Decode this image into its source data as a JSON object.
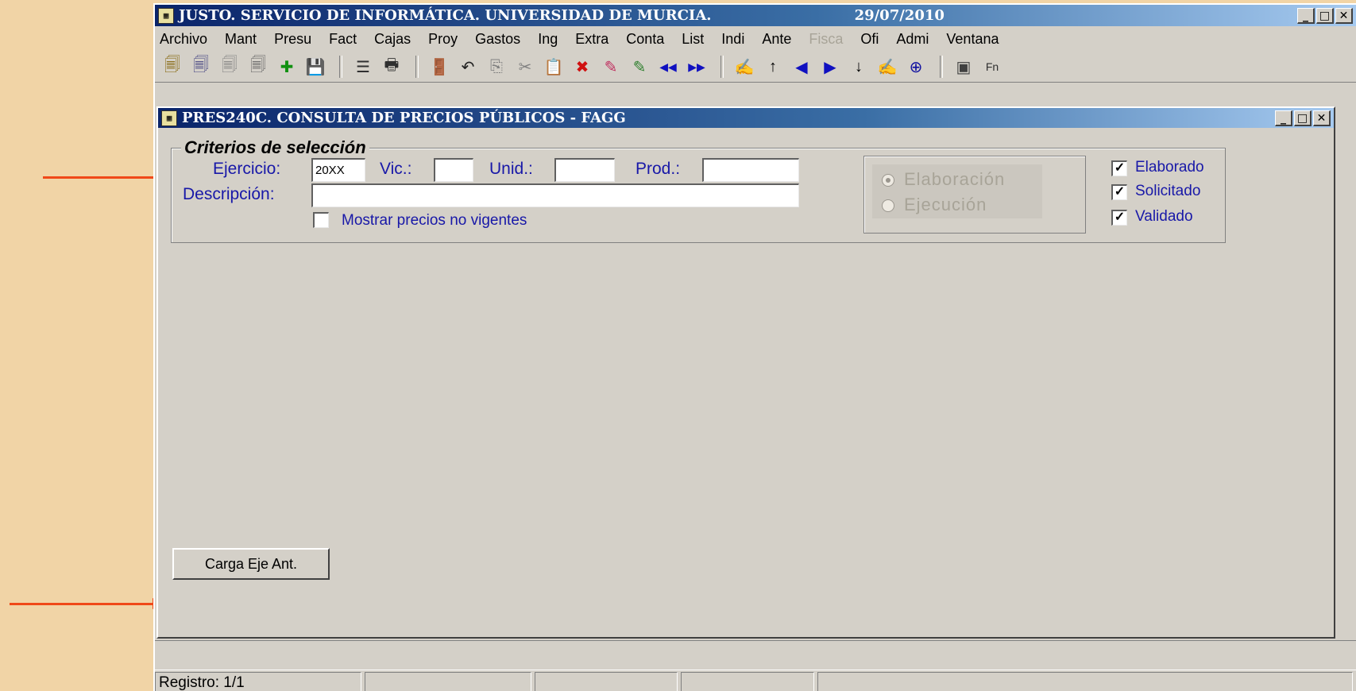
{
  "app": {
    "title": "JUSTO. SERVICIO DE INFORMÁTICA. UNIVERSIDAD DE MURCIA.",
    "date": "29/07/2010",
    "icon_text": "▦"
  },
  "menu": [
    {
      "label": "Archivo",
      "disabled": false
    },
    {
      "label": "Mant",
      "disabled": false
    },
    {
      "label": "Presu",
      "disabled": false
    },
    {
      "label": "Fact",
      "disabled": false
    },
    {
      "label": "Cajas",
      "disabled": false
    },
    {
      "label": "Proy",
      "disabled": false
    },
    {
      "label": "Gastos",
      "disabled": false
    },
    {
      "label": "Ing",
      "disabled": false
    },
    {
      "label": "Extra",
      "disabled": false
    },
    {
      "label": "Conta",
      "disabled": false
    },
    {
      "label": "List",
      "disabled": false
    },
    {
      "label": "Indi",
      "disabled": false
    },
    {
      "label": "Ante",
      "disabled": false
    },
    {
      "label": "Fisca",
      "disabled": true
    },
    {
      "label": "Ofi",
      "disabled": false
    },
    {
      "label": "Admi",
      "disabled": false
    },
    {
      "label": "Ventana",
      "disabled": false
    }
  ],
  "toolbar": {
    "icons": [
      {
        "name": "query-icon",
        "glyph": "🗐",
        "color": "#806000"
      },
      {
        "name": "execute-query-icon",
        "glyph": "🗐",
        "color": "#404080"
      },
      {
        "name": "cancel-query-icon",
        "glyph": "🗐",
        "color": "#808080"
      },
      {
        "name": "count-query-icon",
        "glyph": "🗐",
        "color": "#606060"
      },
      {
        "name": "insert-record-icon",
        "glyph": "✚",
        "color": "#109010"
      },
      {
        "name": "save-icon",
        "glyph": "💾",
        "color": "#202080"
      },
      {
        "sep": true
      },
      {
        "name": "print-preview-icon",
        "glyph": "☰",
        "color": "#303030"
      },
      {
        "name": "print-icon",
        "glyph": "🖶",
        "color": "#303030"
      },
      {
        "sep": true
      },
      {
        "name": "exit-icon",
        "glyph": "🚪",
        "color": "#106060"
      },
      {
        "name": "undo-icon",
        "glyph": "↶",
        "color": "#202020"
      },
      {
        "name": "copy-icon",
        "glyph": "⎘",
        "color": "#808080"
      },
      {
        "name": "cut-icon",
        "glyph": "✂",
        "color": "#808080"
      },
      {
        "name": "paste-icon",
        "glyph": "📋",
        "color": "#404040"
      },
      {
        "name": "delete-record-icon",
        "glyph": "✖",
        "color": "#d01010"
      },
      {
        "name": "clear-field-icon",
        "glyph": "✎",
        "color": "#c03060"
      },
      {
        "name": "clear-record-icon",
        "glyph": "✎",
        "color": "#308030"
      },
      {
        "name": "first-record-icon",
        "glyph": "◀◀",
        "color": "#1010c0"
      },
      {
        "name": "last-record-icon",
        "glyph": "▶▶",
        "color": "#1010c0"
      },
      {
        "sep": true
      },
      {
        "name": "list-of-values-icon",
        "glyph": "✍",
        "color": "#2060a0"
      },
      {
        "name": "previous-block-icon",
        "glyph": "↑",
        "color": "#000000"
      },
      {
        "name": "previous-record-icon",
        "glyph": "◀",
        "color": "#1010c0"
      },
      {
        "name": "next-record-icon",
        "glyph": "▶",
        "color": "#1010c0"
      },
      {
        "name": "next-block-icon",
        "glyph": "↓",
        "color": "#000000"
      },
      {
        "name": "edit-icon",
        "glyph": "✍",
        "color": "#2060a0"
      },
      {
        "name": "zoom-icon",
        "glyph": "⊕",
        "color": "#1010a0"
      },
      {
        "sep": true
      },
      {
        "name": "notes-icon",
        "glyph": "▣",
        "color": "#404040"
      },
      {
        "name": "function-keys-icon",
        "glyph": "Fn",
        "color": "#303030"
      }
    ]
  },
  "form": {
    "title": "PRES240C. CONSULTA DE PRECIOS PÚBLICOS - FAGG",
    "criteria_legend": "Criterios de selección",
    "ejercicio_label": "Ejercicio:",
    "ejercicio_value": "20XX",
    "vic_label": "Vic.:",
    "vic_value": "",
    "unid_label": "Unid.:",
    "unid_value": "",
    "prod_label": "Prod.:",
    "prod_value": "",
    "descripcion_label": "Descripción:",
    "descripcion_value": "",
    "mostrar_label": "Mostrar precios no vigentes",
    "mostrar_checked": false,
    "radio_elaboracion": "Elaboración",
    "radio_ejecucion": "Ejecución",
    "radio_selected": "Elaboración",
    "chk_elaborado": "Elaborado",
    "chk_solicitado": "Solicitado",
    "chk_validado": "Validado",
    "chk_elaborado_checked": true,
    "chk_solicitado_checked": true,
    "chk_validado_checked": true,
    "button_label": "Carga Eje Ant."
  },
  "status": {
    "registro": "Registro: 1/1"
  },
  "colors": {
    "title_gradient_start": "#0a246a",
    "label_blue": "#1818a8",
    "arrow": "#f04818",
    "window_face": "#d4d0c8"
  }
}
